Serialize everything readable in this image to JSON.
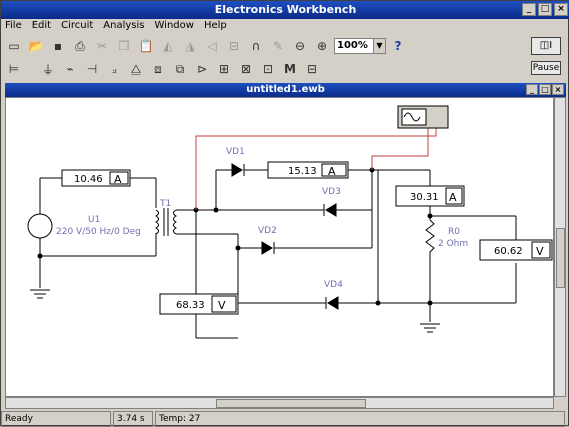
{
  "window": {
    "title": "Electronics Workbench",
    "buttons": [
      "_",
      "□",
      "×"
    ]
  },
  "menu": [
    "File",
    "Edit",
    "Circuit",
    "Analysis",
    "Window",
    "Help"
  ],
  "toolbar1": {
    "zoom": "100%",
    "help_label": "?"
  },
  "right_panel": {
    "pause_label": "Pause"
  },
  "document": {
    "title": "untitled1.ewb"
  },
  "circuit": {
    "source_ref": "U1",
    "source_desc": "220 V/50 Hz/0 Deg",
    "transformer_ref": "T1",
    "diodes": [
      "VD1",
      "VD2",
      "VD3",
      "VD4"
    ],
    "resistor_ref": "R0",
    "resistor_value": "2  Ohm",
    "meters": {
      "m1": {
        "value": "10.46",
        "unit": "A"
      },
      "m2": {
        "value": "15.13",
        "unit": "A"
      },
      "m3": {
        "value": "30.31",
        "unit": "A"
      },
      "m4": {
        "value": "60.62",
        "unit": "V"
      },
      "m5": {
        "value": "68.33",
        "unit": "V"
      }
    }
  },
  "status": {
    "state": "Ready",
    "time": "3.74 s",
    "temp": "Temp:  27"
  }
}
